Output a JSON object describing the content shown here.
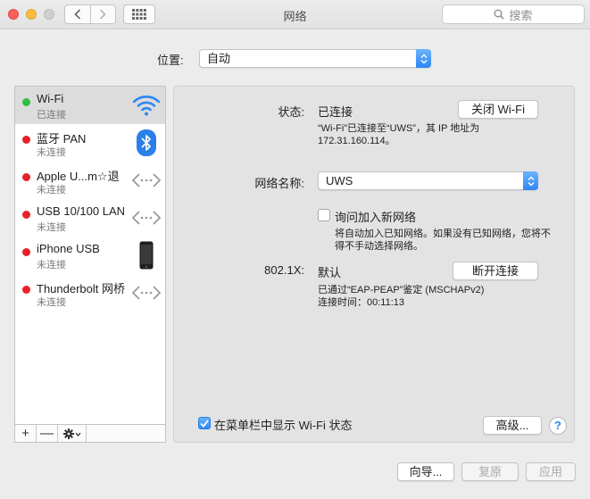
{
  "window": {
    "title": "网络",
    "search_placeholder": "搜索"
  },
  "location": {
    "label": "位置:",
    "value": "自动"
  },
  "services": [
    {
      "name": "Wi-Fi",
      "status": "已连接",
      "dot_color": "#2fc23f",
      "icon": "wifi-icon",
      "selected": true
    },
    {
      "name": "蓝牙 PAN",
      "status": "未连接",
      "dot_color": "#e8202a",
      "icon": "bluetooth-icon"
    },
    {
      "name": "Apple U...m☆退",
      "status": "未连接",
      "dot_color": "#e8202a",
      "icon": "ethernet-arrows-icon"
    },
    {
      "name": "USB 10/100 LAN",
      "status": "未连接",
      "dot_color": "#e8202a",
      "icon": "ethernet-arrows-icon"
    },
    {
      "name": "iPhone USB",
      "status": "未连接",
      "dot_color": "#e8202a",
      "icon": "iphone-icon"
    },
    {
      "name": "Thunderbolt 网桥",
      "status": "未连接",
      "dot_color": "#e8202a",
      "icon": "ethernet-arrows-icon"
    }
  ],
  "sidebar_toolbar": {
    "add": "+",
    "remove": "—"
  },
  "detail": {
    "status_label": "状态:",
    "status_value": "已连接",
    "turn_off_button": "关闭 Wi-Fi",
    "status_desc_line1": "“Wi-Fi”已连接至“UWS”，其 IP 地址为",
    "status_desc_line2": "172.31.160.114。",
    "network_name_label": "网络名称:",
    "network_name_value": "UWS",
    "ask_join_label": "询问加入新网络",
    "ask_join_desc_line1": "将自动加入已知网络。如果没有已知网络，您将不",
    "ask_join_desc_line2": "得不手动选择网络。",
    "dot1x_label": "802.1X:",
    "dot1x_value": "默认",
    "disconnect_button": "断开连接",
    "auth_line": "已通过“EAP-PEAP”鉴定 (MSCHAPv2)",
    "connect_time_line": "连接时间：00:11:13",
    "show_menubar_label": "在菜单栏中显示 Wi-Fi 状态",
    "advanced_button": "高级...",
    "help_label": "?"
  },
  "footer": {
    "assist": "向导...",
    "revert": "复原",
    "apply": "应用"
  },
  "colors": {
    "accent": "#2d87f5",
    "connected": "#2fc23f",
    "disconnected": "#e8202a"
  }
}
